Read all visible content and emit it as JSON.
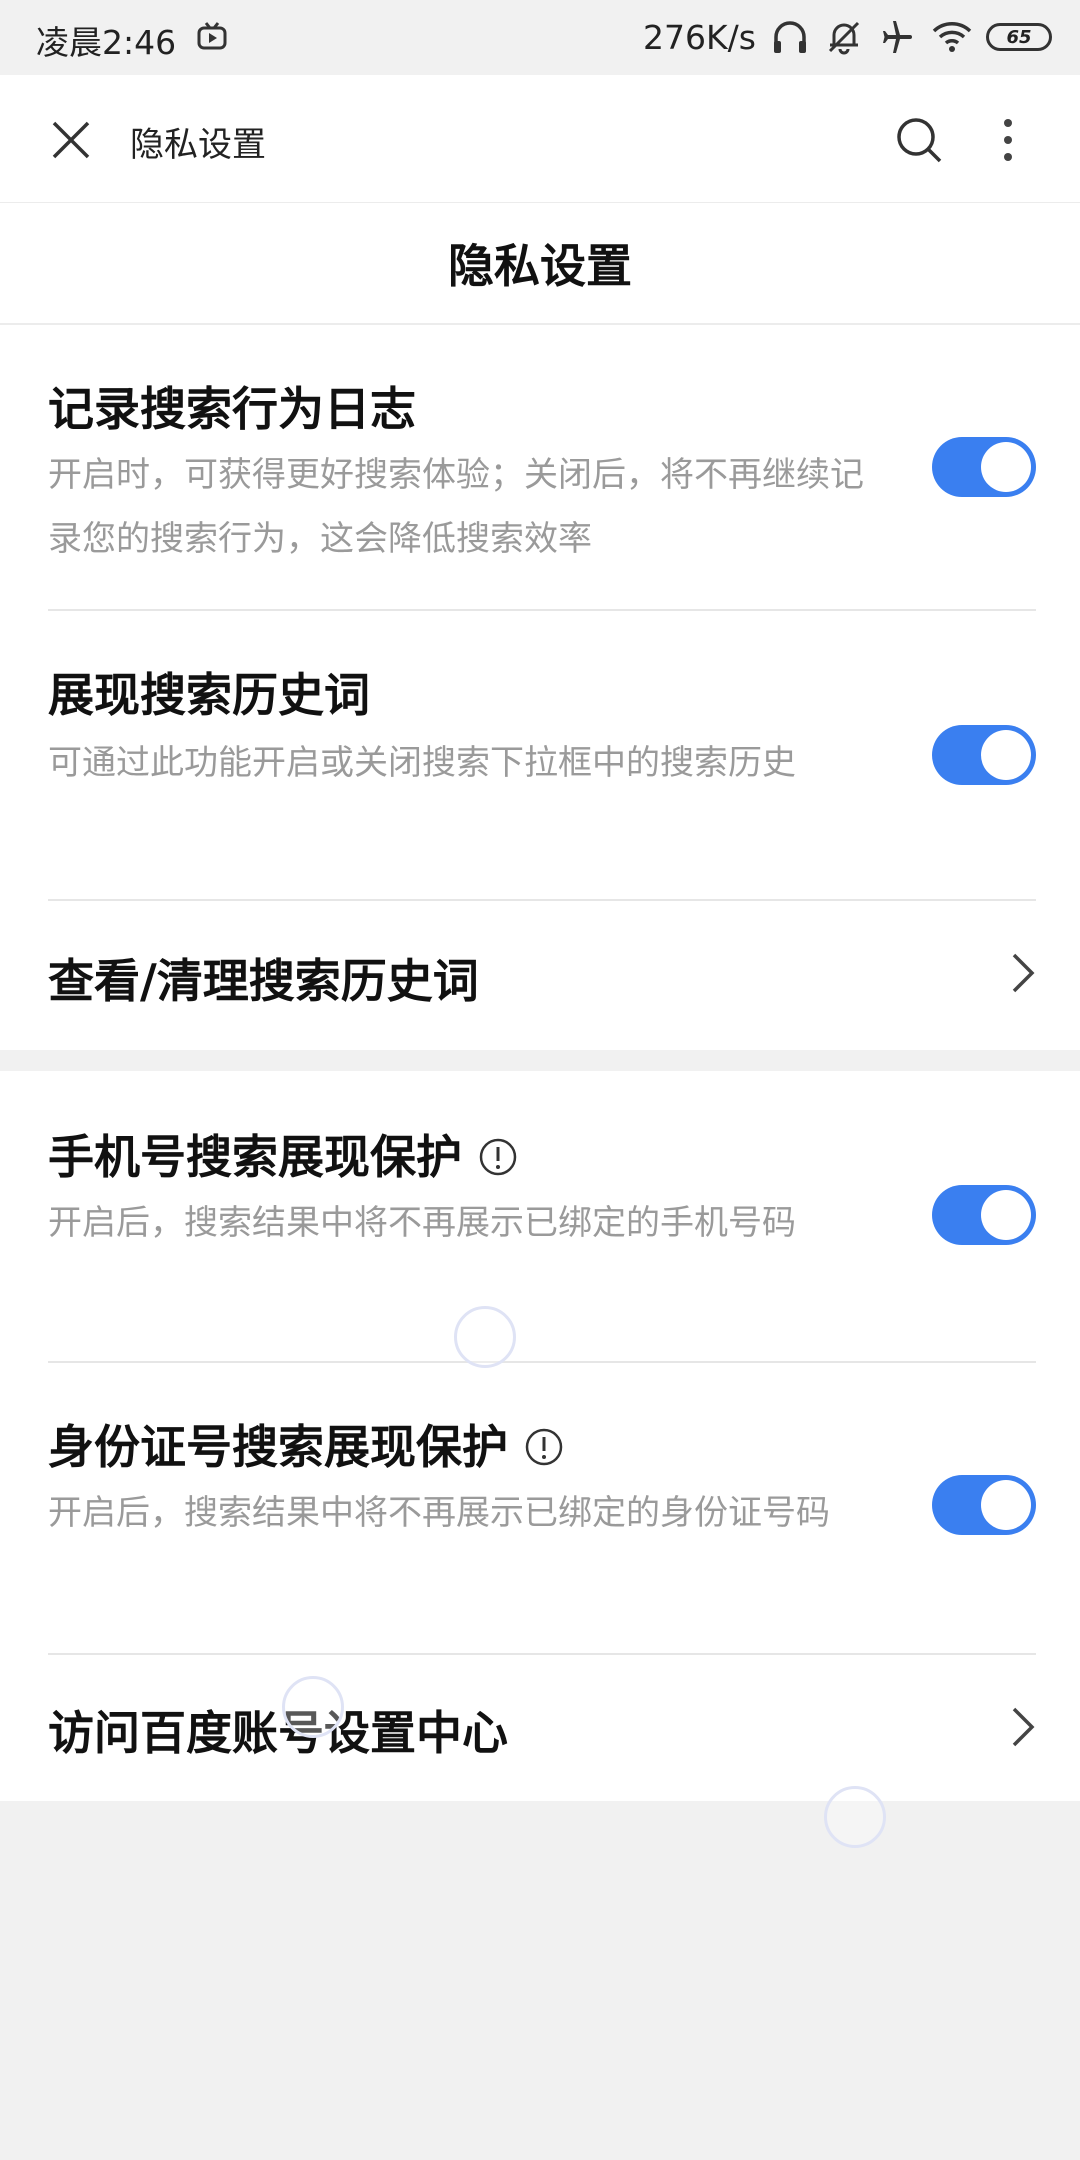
{
  "status_bar": {
    "time": "凌晨2:46",
    "net_speed": "276K/s",
    "battery": "65"
  },
  "toolbar": {
    "title": "隐私设置"
  },
  "page": {
    "title": "隐私设置"
  },
  "settings": [
    {
      "title": "记录搜索行为日志",
      "desc": "开启时，可获得更好搜索体验；关闭后，将不再继续记录您的搜索行为，这会降低搜索效率",
      "toggle_on": true
    },
    {
      "title": "展现搜索历史词",
      "desc": "可通过此功能开启或关闭搜索下拉框中的搜索历史",
      "toggle_on": true
    },
    {
      "title": "查看/清理搜索历史词"
    },
    {
      "title": "手机号搜索展现保护",
      "desc": "开启后，搜索结果中将不再展示已绑定的手机号码",
      "toggle_on": true
    },
    {
      "title": "身份证号搜索展现保护",
      "desc": "开启后，搜索结果中将不再展示已绑定的身份证号码",
      "toggle_on": true
    },
    {
      "title": "访问百度账号设置中心"
    }
  ],
  "colors": {
    "accent": "#3a7ff0",
    "desc_text": "#9a9a9a",
    "background": "#f1f1f1"
  }
}
